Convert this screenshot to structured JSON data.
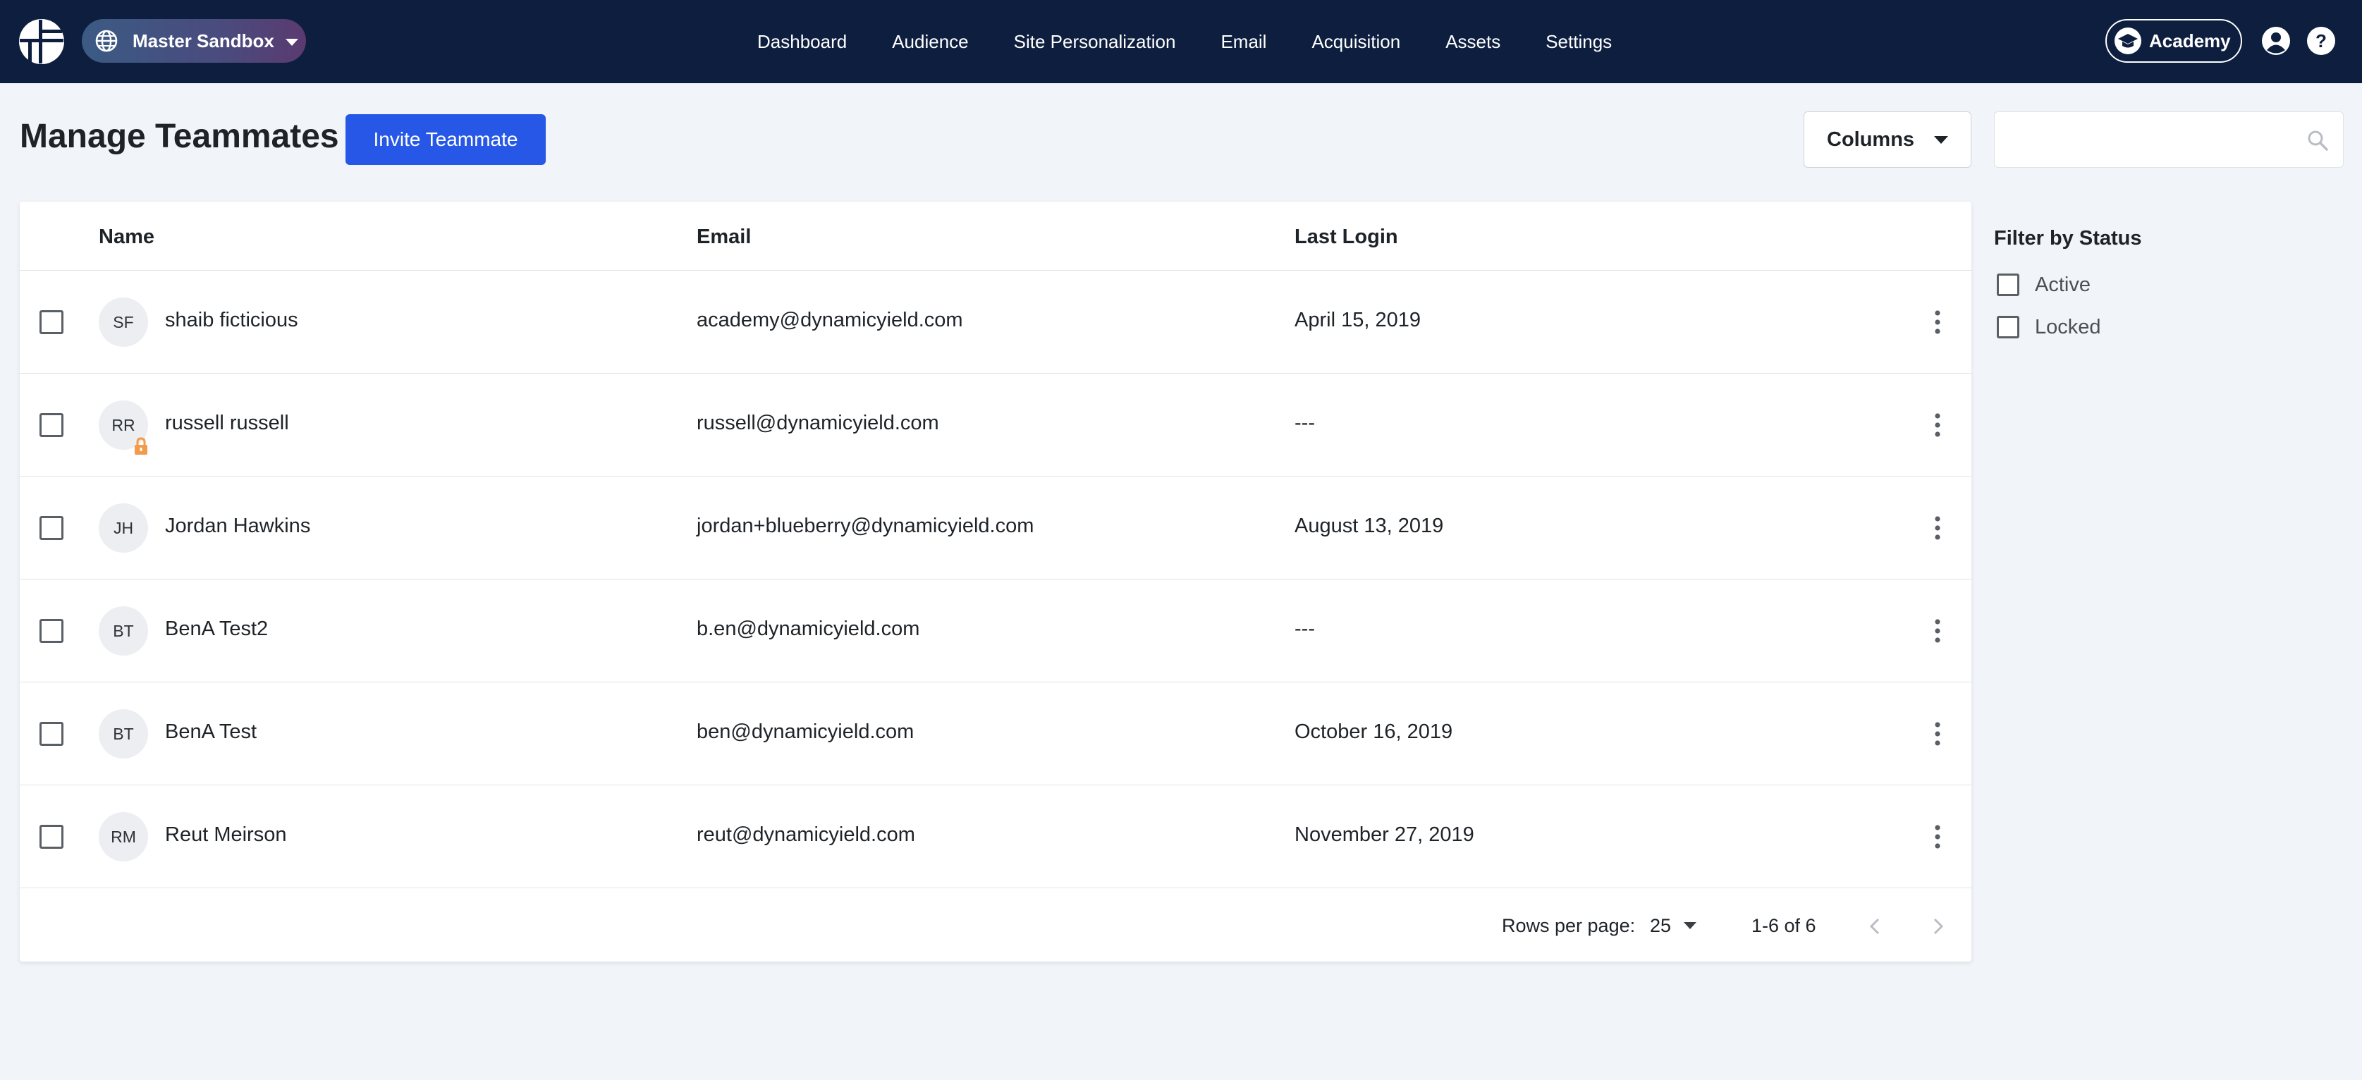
{
  "topbar": {
    "environment": "Master Sandbox",
    "nav": [
      "Dashboard",
      "Audience",
      "Site Personalization",
      "Email",
      "Acquisition",
      "Assets",
      "Settings"
    ],
    "academy_label": "Academy",
    "colors": {
      "bar": "#0d1e3f",
      "env_pill_start": "#3b5b84",
      "env_pill_end": "#5a3a70"
    },
    "icons": [
      "logo-icon",
      "globe-icon",
      "graduation-cap-icon",
      "user-icon",
      "help-icon"
    ]
  },
  "header": {
    "title": "Manage Teammates",
    "invite_label": "Invite Teammate",
    "columns_label": "Columns",
    "search_placeholder": "",
    "colors": {
      "primary": "#2657e6"
    }
  },
  "table": {
    "columns": [
      "Name",
      "Email",
      "Last Login"
    ],
    "rows": [
      {
        "initials": "SF",
        "name": "shaib ficticious",
        "email": "academy@dynamicyield.com",
        "last_login": "April 15, 2019",
        "locked": false
      },
      {
        "initials": "RR",
        "name": "russell russell",
        "email": "russell@dynamicyield.com",
        "last_login": "---",
        "locked": true
      },
      {
        "initials": "JH",
        "name": "Jordan Hawkins",
        "email": "jordan+blueberry@dynamicyield.com",
        "last_login": "August 13, 2019",
        "locked": false
      },
      {
        "initials": "BT",
        "name": "BenA Test2",
        "email": "b.en@dynamicyield.com",
        "last_login": "---",
        "locked": false
      },
      {
        "initials": "BT",
        "name": "BenA Test",
        "email": "ben@dynamicyield.com",
        "last_login": "October 16, 2019",
        "locked": false
      },
      {
        "initials": "RM",
        "name": "Reut Meirson",
        "email": "reut@dynamicyield.com",
        "last_login": "November 27, 2019",
        "locked": false
      }
    ],
    "footer": {
      "rows_per_page_label": "Rows per page:",
      "rows_per_page_value": "25",
      "range": "1-6 of 6"
    },
    "colors": {
      "lock": "#f29b4b"
    }
  },
  "filter": {
    "title": "Filter by Status",
    "options": [
      "Active",
      "Locked"
    ]
  }
}
